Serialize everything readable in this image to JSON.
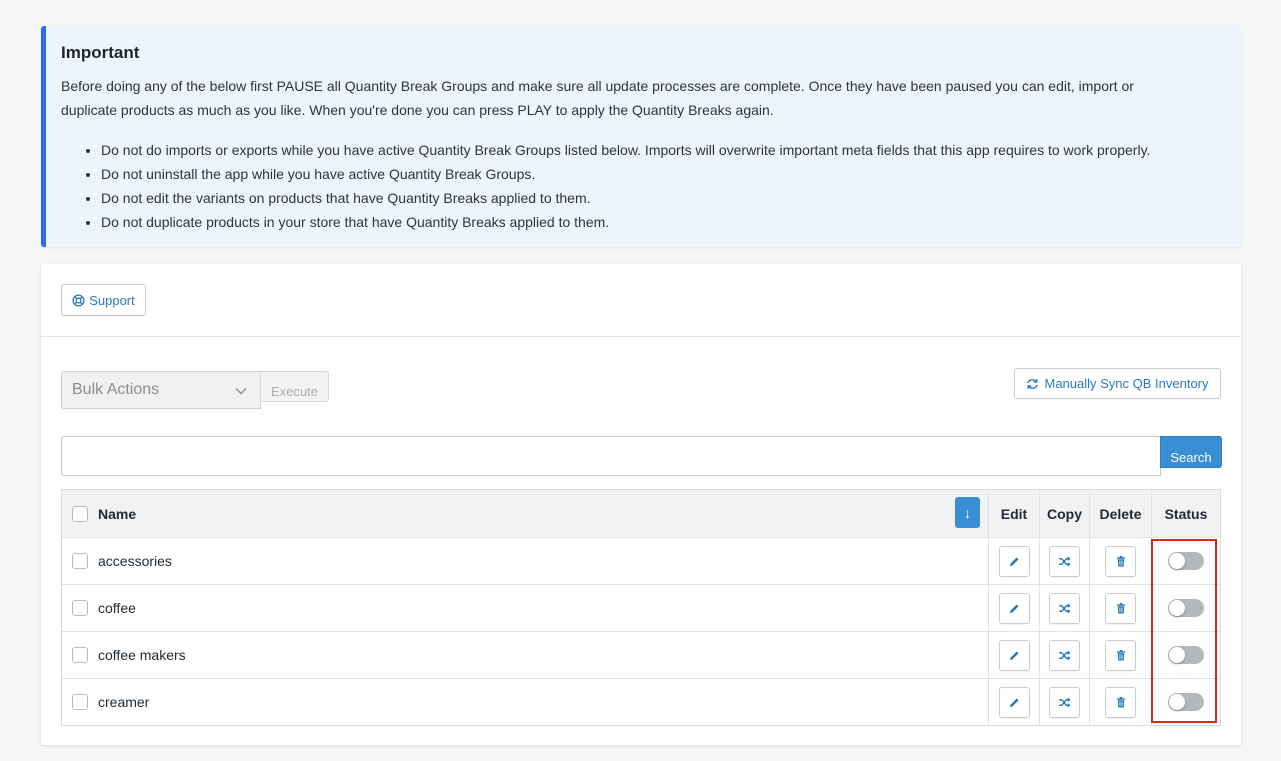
{
  "notice": {
    "title": "Important",
    "paragraph": "Before doing any of the below first PAUSE all Quantity Break Groups and make sure all update processes are complete. Once they have been paused you can edit, import or duplicate products as much as you like. When you're done you can press PLAY to apply the Quantity Breaks again.",
    "bullets": [
      "Do not do imports or exports while you have active Quantity Break Groups listed below. Imports will overwrite important meta fields that this app requires to work properly.",
      "Do not uninstall the app while you have active Quantity Break Groups.",
      "Do not edit the variants on products that have Quantity Breaks applied to them.",
      "Do not duplicate products in your store that have Quantity Breaks applied to them."
    ],
    "accent_color": "#2f6fe4"
  },
  "toolbar": {
    "support_label": "Support",
    "bulk_actions_label": "Bulk Actions",
    "execute_label": "Execute",
    "sync_label": "Manually Sync QB Inventory",
    "search_placeholder": "",
    "search_label": "Search"
  },
  "table": {
    "headers": {
      "name": "Name",
      "edit": "Edit",
      "copy": "Copy",
      "delete": "Delete",
      "status": "Status"
    },
    "sort_icon": "arrow-down-icon",
    "rows": [
      {
        "name": "accessories",
        "status": "off"
      },
      {
        "name": "coffee",
        "status": "off"
      },
      {
        "name": "coffee makers",
        "status": "off"
      },
      {
        "name": "creamer",
        "status": "off"
      }
    ]
  },
  "colors": {
    "primary": "#3a8fd4",
    "link": "#2a7ab8",
    "highlight": "#e0261a"
  }
}
